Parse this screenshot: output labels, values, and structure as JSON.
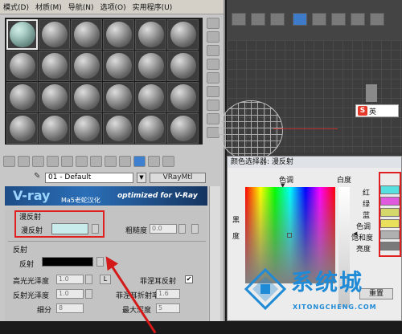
{
  "material_editor": {
    "menu": [
      "模式(D)",
      "材质(M)",
      "导航(N)",
      "选项(O)",
      "实用程序(U)"
    ],
    "material_name": "01 - Default",
    "material_type": "VRayMtl",
    "banner": {
      "logo": "V-ray",
      "middle": "Ma5老蛇汉化",
      "subtitle": "optimized for V-Ray"
    },
    "diffuse_group_title": "漫反射",
    "diffuse_label": "漫反射",
    "diffuse_color": "#c8ecec",
    "roughness_label": "粗糙度",
    "roughness_value": "0.0",
    "reflect_group_title": "反射",
    "reflect_label": "反射",
    "reflect_color": "#000000",
    "hilight_gloss_label": "高光光泽度",
    "hilight_gloss_value": "1.0",
    "lock_label": "L",
    "fresnel_label": "菲涅耳反射",
    "fresnel_check": "✔",
    "refl_gloss_label": "反射光泽度",
    "refl_gloss_value": "1.0",
    "fresnel_ior_label": "菲涅耳折射率",
    "fresnel_ior_value": "1.6",
    "subdivs_label": "细分",
    "subdivs_value": "8",
    "max_depth_label": "最大深度",
    "max_depth_value": "5"
  },
  "viewport": {
    "ime_label": "英"
  },
  "color_picker": {
    "title": "颜色选择器: 漫反射",
    "hue_label": "色调",
    "whiteness_label": "白度",
    "blackness_label": "黑",
    "side_label": "度",
    "slider_labels": [
      "红",
      "绿",
      "蓝",
      "色调",
      "饱和度",
      "亮度"
    ],
    "slider_colors": [
      "#56e0e0",
      "#e05ae0",
      "#d4d86a",
      "#e8e05a",
      "#b0b0b0",
      "#7a7a7a"
    ],
    "reset_label": "重置"
  },
  "watermark": {
    "text": "系统城",
    "url": "XITONGCHENG.COM"
  }
}
